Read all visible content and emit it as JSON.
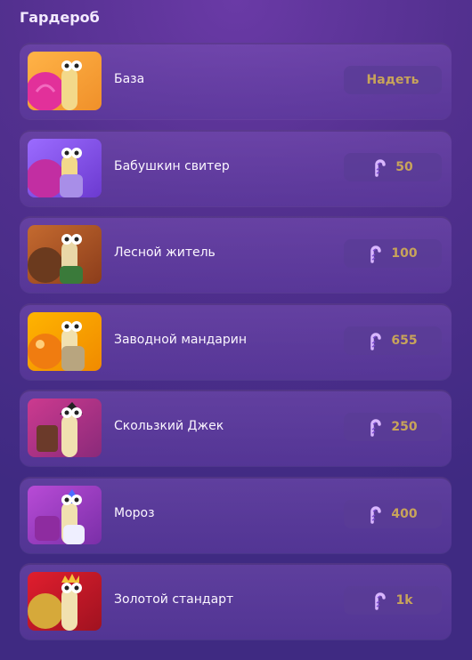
{
  "header": {
    "title": "Гардероб"
  },
  "items": [
    {
      "name": "База",
      "button": "Надеть",
      "price": null
    },
    {
      "name": "Бабушкин свитер",
      "button": "50",
      "price": "50"
    },
    {
      "name": "Лесной житель",
      "button": "100",
      "price": "100"
    },
    {
      "name": "Заводной мандарин",
      "button": "655",
      "price": "655"
    },
    {
      "name": "Скользкий Джек",
      "button": "250",
      "price": "250"
    },
    {
      "name": "Мороз",
      "button": "400",
      "price": "400"
    },
    {
      "name": "Золотой стандарт",
      "button": "1k",
      "price": "1k"
    }
  ],
  "colors": {
    "price_text": "#c8a45a",
    "background": "#53308f"
  },
  "icons": [
    "candy-cane-icon"
  ]
}
